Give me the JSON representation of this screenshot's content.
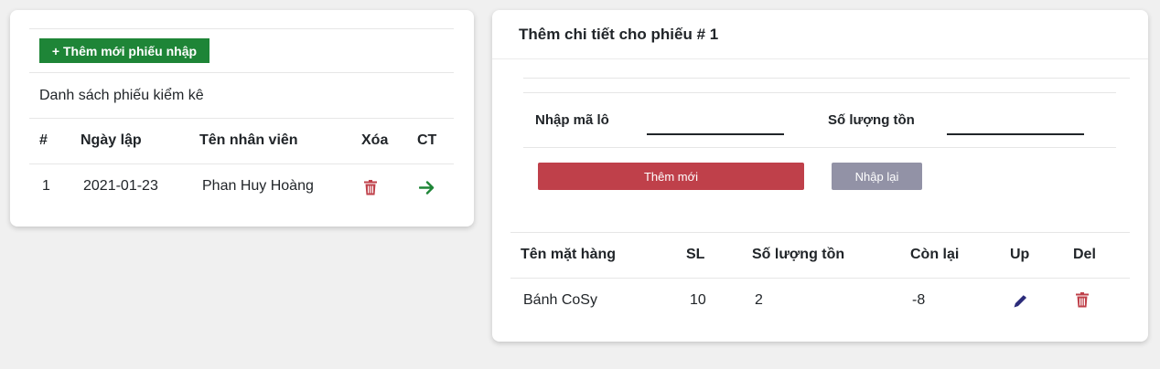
{
  "left": {
    "add_button_label": "+ Thêm mới phiếu nhập",
    "list_title": "Danh sách phiếu kiểm kê",
    "columns": [
      "#",
      "Ngày lập",
      "Tên nhân viên",
      "Xóa",
      "CT"
    ],
    "rows": [
      {
        "no": "1",
        "date": "2021-01-23",
        "employee": "Phan Huy Hoàng"
      }
    ],
    "delete_icon": "trash-icon",
    "detail_icon": "arrow-right-icon",
    "colors": {
      "add_button": "#1e8537",
      "delete": "#bf404a",
      "detail": "#1e8537"
    }
  },
  "right": {
    "title": "Thêm chi tiết cho phiếu # 1",
    "form": {
      "lot_label": "Nhập mã lô",
      "lot_value": "",
      "stock_label": "Số lượng tồn",
      "stock_value": ""
    },
    "add_button_label": "Thêm mới",
    "reset_button_label": "Nhập lại",
    "columns": [
      "Tên mặt hàng",
      "SL",
      "Số lượng tồn",
      "Còn lại",
      "Up",
      "Del"
    ],
    "rows": [
      {
        "name": "Bánh CoSy",
        "qty": "10",
        "stock": "2",
        "remaining": "-8"
      }
    ],
    "edit_icon": "pencil-icon",
    "delete_icon": "trash-icon",
    "colors": {
      "add_button": "#bf404a",
      "reset_button": "#9292a6",
      "edit": "#2b2b7a",
      "delete": "#bf404a"
    }
  }
}
